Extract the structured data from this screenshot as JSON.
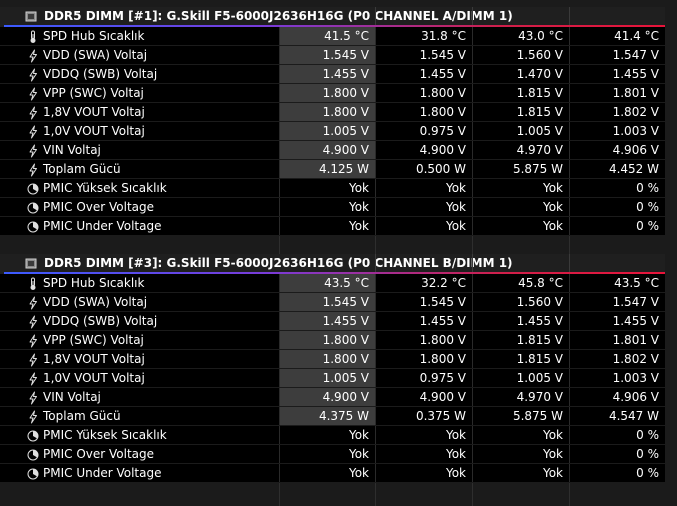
{
  "sections": [
    {
      "title": "DDR5 DIMM [#1]: G.Skill F5-6000J2636H16G (P0 CHANNEL A/DIMM 1)",
      "rows": [
        {
          "icon": "thermometer-icon",
          "label": "SPD Hub Sıcaklık",
          "v": [
            "41.5 °C",
            "31.8 °C",
            "43.0 °C",
            "41.4 °C"
          ]
        },
        {
          "icon": "lightning-icon",
          "label": "VDD (SWA) Voltaj",
          "v": [
            "1.545 V",
            "1.545 V",
            "1.560 V",
            "1.547 V"
          ]
        },
        {
          "icon": "lightning-icon",
          "label": "VDDQ (SWB) Voltaj",
          "v": [
            "1.455 V",
            "1.455 V",
            "1.470 V",
            "1.455 V"
          ]
        },
        {
          "icon": "lightning-icon",
          "label": "VPP (SWC) Voltaj",
          "v": [
            "1.800 V",
            "1.800 V",
            "1.815 V",
            "1.801 V"
          ]
        },
        {
          "icon": "lightning-icon",
          "label": "1,8V VOUT Voltaj",
          "v": [
            "1.800 V",
            "1.800 V",
            "1.815 V",
            "1.802 V"
          ]
        },
        {
          "icon": "lightning-icon",
          "label": "1,0V VOUT Voltaj",
          "v": [
            "1.005 V",
            "0.975 V",
            "1.005 V",
            "1.003 V"
          ]
        },
        {
          "icon": "lightning-icon",
          "label": "VIN Voltaj",
          "v": [
            "4.900 V",
            "4.900 V",
            "4.970 V",
            "4.906 V"
          ]
        },
        {
          "icon": "lightning-icon",
          "label": "Toplam Gücü",
          "v": [
            "4.125 W",
            "0.500 W",
            "5.875 W",
            "4.452 W"
          ]
        },
        {
          "icon": "clock-icon",
          "label": "PMIC Yüksek Sıcaklık",
          "v": [
            "Yok",
            "Yok",
            "Yok",
            "0 %"
          ]
        },
        {
          "icon": "clock-icon",
          "label": "PMIC Over Voltage",
          "v": [
            "Yok",
            "Yok",
            "Yok",
            "0 %"
          ]
        },
        {
          "icon": "clock-icon",
          "label": "PMIC Under Voltage",
          "v": [
            "Yok",
            "Yok",
            "Yok",
            "0 %"
          ]
        }
      ]
    },
    {
      "title": "DDR5 DIMM [#3]: G.Skill F5-6000J2636H16G (P0 CHANNEL B/DIMM 1)",
      "rows": [
        {
          "icon": "thermometer-icon",
          "label": "SPD Hub Sıcaklık",
          "v": [
            "43.5 °C",
            "32.2 °C",
            "45.8 °C",
            "43.5 °C"
          ]
        },
        {
          "icon": "lightning-icon",
          "label": "VDD (SWA) Voltaj",
          "v": [
            "1.545 V",
            "1.545 V",
            "1.560 V",
            "1.547 V"
          ]
        },
        {
          "icon": "lightning-icon",
          "label": "VDDQ (SWB) Voltaj",
          "v": [
            "1.455 V",
            "1.455 V",
            "1.455 V",
            "1.455 V"
          ]
        },
        {
          "icon": "lightning-icon",
          "label": "VPP (SWC) Voltaj",
          "v": [
            "1.800 V",
            "1.800 V",
            "1.815 V",
            "1.801 V"
          ]
        },
        {
          "icon": "lightning-icon",
          "label": "1,8V VOUT Voltaj",
          "v": [
            "1.800 V",
            "1.800 V",
            "1.815 V",
            "1.802 V"
          ]
        },
        {
          "icon": "lightning-icon",
          "label": "1,0V VOUT Voltaj",
          "v": [
            "1.005 V",
            "0.975 V",
            "1.005 V",
            "1.003 V"
          ]
        },
        {
          "icon": "lightning-icon",
          "label": "VIN Voltaj",
          "v": [
            "4.900 V",
            "4.900 V",
            "4.970 V",
            "4.906 V"
          ]
        },
        {
          "icon": "lightning-icon",
          "label": "Toplam Gücü",
          "v": [
            "4.375 W",
            "0.375 W",
            "5.875 W",
            "4.547 W"
          ]
        },
        {
          "icon": "clock-icon",
          "label": "PMIC Yüksek Sıcaklık",
          "v": [
            "Yok",
            "Yok",
            "Yok",
            "0 %"
          ]
        },
        {
          "icon": "clock-icon",
          "label": "PMIC Over Voltage",
          "v": [
            "Yok",
            "Yok",
            "Yok",
            "0 %"
          ]
        },
        {
          "icon": "clock-icon",
          "label": "PMIC Under Voltage",
          "v": [
            "Yok",
            "Yok",
            "Yok",
            "0 %"
          ]
        }
      ]
    }
  ],
  "highlighted_current_rows": [
    0,
    1,
    2,
    3,
    4,
    5,
    6,
    7
  ],
  "colors": {
    "accent_start": "#3b5bff",
    "accent_end": "#e8143a",
    "row_bg": "#000000",
    "current_highlight": "#3d3d3d"
  }
}
